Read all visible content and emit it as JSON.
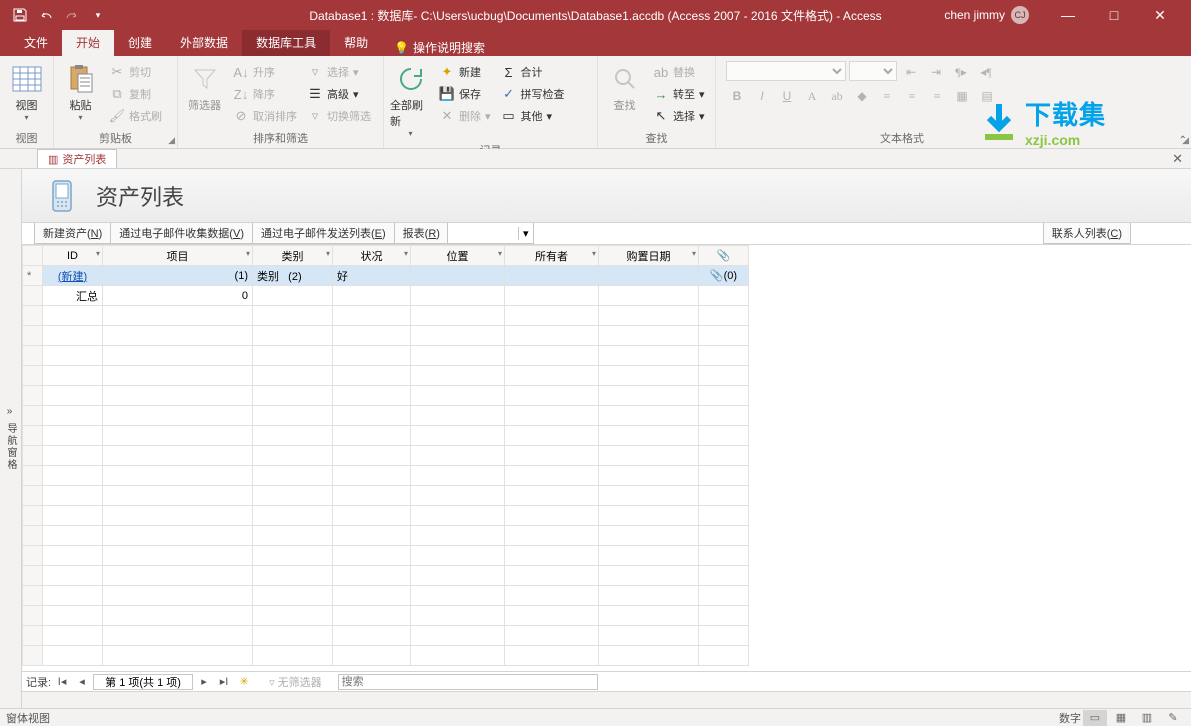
{
  "titlebar": {
    "title": "Database1 : 数据库- C:\\Users\\ucbug\\Documents\\Database1.accdb (Access 2007 - 2016 文件格式) -  Access",
    "user_name": "chen jimmy",
    "user_initials": "CJ"
  },
  "ribbon_tabs": {
    "file": "文件",
    "home": "开始",
    "create": "创建",
    "external": "外部数据",
    "dbtools": "数据库工具",
    "help": "帮助",
    "tellme": "操作说明搜索"
  },
  "ribbon": {
    "view_group": "视图",
    "view": "视图",
    "clipboard_group": "剪贴板",
    "paste": "粘贴",
    "cut": "剪切",
    "copy": "复制",
    "format_painter": "格式刷",
    "sort_group": "排序和筛选",
    "filter": "筛选器",
    "asc": "升序",
    "desc": "降序",
    "clear_sort": "取消排序",
    "selection": "选择",
    "advanced": "高级",
    "toggle_filter": "切换筛选",
    "records_group": "记录",
    "refresh_all": "全部刷新",
    "new": "新建",
    "save": "保存",
    "delete": "删除",
    "totals": "合计",
    "spell": "拼写检查",
    "more": "其他",
    "find_group": "查找",
    "find": "查找",
    "replace": "替换",
    "goto": "转至",
    "select": "选择",
    "text_group": "文本格式"
  },
  "doc_tab": {
    "label": "资产列表"
  },
  "navpane": {
    "label": "导航窗格"
  },
  "form": {
    "title": "资产列表",
    "toolbar": {
      "new_asset": "新建资产(N)",
      "collect_email": "通过电子邮件收集数据(V)",
      "send_email": "通过电子邮件发送列表(E)",
      "reports": "报表(R)",
      "contacts": "联系人列表(C)"
    }
  },
  "datasheet": {
    "cols": {
      "id": "ID",
      "item": "项目",
      "category": "类别",
      "condition": "状况",
      "location": "位置",
      "owner": "所有者",
      "acquired": "购置日期",
      "attach": "📎"
    },
    "new_row": {
      "id_label": "(新建)",
      "category": "类别",
      "condition": "好",
      "attach": "📎(0)"
    },
    "summary_label": "汇总",
    "summary_value": "0"
  },
  "recnav": {
    "label": "记录:",
    "position": "第 1 项(共 1 项)",
    "no_filter": "无筛选器",
    "search": "搜索"
  },
  "status": {
    "left": "窗体视图",
    "numlock": "数字"
  },
  "watermark": {
    "name": "下载集",
    "url": "xzji.com"
  }
}
